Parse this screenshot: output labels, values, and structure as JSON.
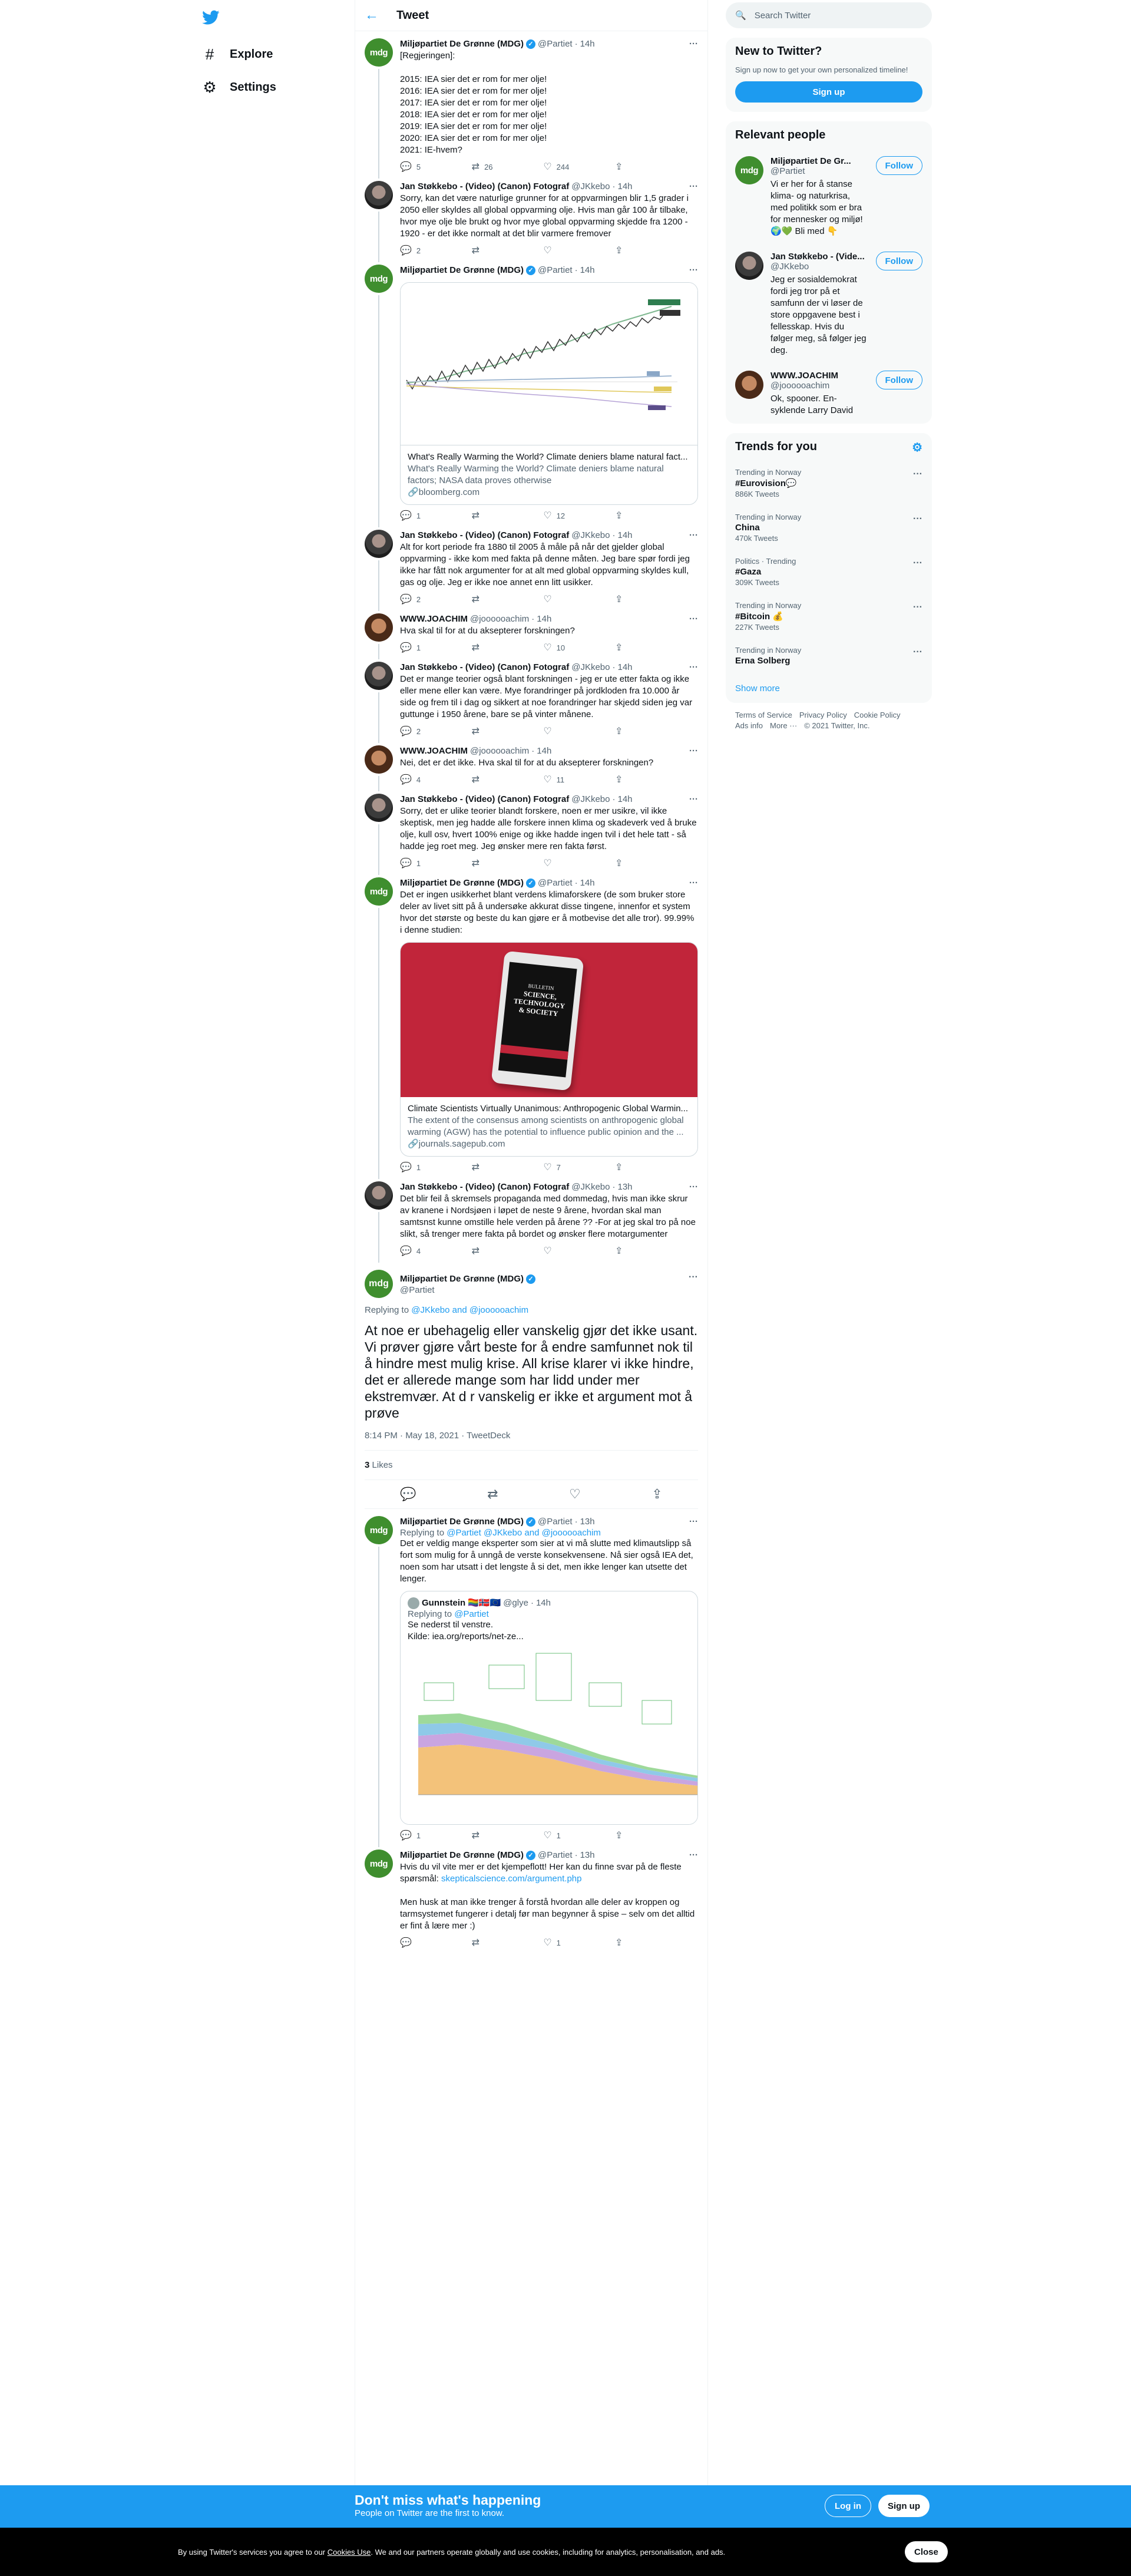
{
  "nav": {
    "items": [
      {
        "icon": "#",
        "label": "Explore"
      },
      {
        "icon": "⚙",
        "label": "Settings"
      }
    ]
  },
  "header": {
    "title": "Tweet"
  },
  "tweets": [
    {
      "name": "Miljøpartiet De Grønne (MDG)",
      "handle": "@Partiet",
      "time": "14h",
      "text": "[Regjeringen]:\n\n2015: IEA sier det er rom for mer olje!\n2016: IEA sier det er rom for mer olje!\n2017: IEA sier det er rom for mer olje!\n2018: IEA sier det er rom for mer olje!\n2019: IEA sier det er rom for mer olje!\n2020: IEA sier det er rom for mer olje!\n2021: IE-hvem?",
      "replies": "5",
      "retweets": "26",
      "likes": "244"
    },
    {
      "name": "Jan Støkkebo - (Video) (Canon) Fotograf",
      "handle": "@JKkebo",
      "time": "14h",
      "text": "Sorry, kan det være naturlige grunner for at oppvarmingen blir 1,5 grader i 2050 eller skyldes all global oppvarming olje. Hvis man går 100 år tilbake, hvor mye olje ble brukt og hvor mye global oppvarming skjedde fra 1200 - 1920 - er det ikke normalt at det blir varmere fremover",
      "replies": "2",
      "retweets": "",
      "likes": ""
    },
    {
      "name": "Miljøpartiet De Grønne (MDG)",
      "handle": "@Partiet",
      "time": "14h",
      "text": "",
      "card": {
        "title": "What's Really Warming the World? Climate deniers blame natural fact...",
        "desc": "What's Really Warming the World? Climate deniers blame natural factors; NASA data proves otherwise",
        "domain": "bloomberg.com"
      },
      "replies": "1",
      "retweets": "",
      "likes": "12"
    },
    {
      "name": "Jan Støkkebo - (Video) (Canon) Fotograf",
      "handle": "@JKkebo",
      "time": "14h",
      "text": "Alt for kort periode fra 1880 til 2005 å måle på når det gjelder global oppvarming - ikke kom med fakta på denne måten. Jeg bare spør fordi jeg ikke har fått nok argumenter for at alt med global oppvarming skyldes kull, gas og olje. Jeg er ikke noe annet enn litt usikker.",
      "replies": "2",
      "retweets": "",
      "likes": ""
    },
    {
      "name": "WWW.JOACHIM",
      "handle": "@joooooachim",
      "time": "14h",
      "text": "Hva skal til for at du aksepterer forskningen?",
      "replies": "1",
      "retweets": "",
      "likes": "10"
    },
    {
      "name": "Jan Støkkebo - (Video) (Canon) Fotograf",
      "handle": "@JKkebo",
      "time": "14h",
      "text": "Det er mange teorier også blant forskningen - jeg er ute etter fakta og ikke eller mene eller kan være. Mye forandringer på jordkloden fra 10.000 år side og frem til i dag og sikkert at noe forandringer har skjedd siden jeg var guttunge i 1950 årene, bare se på vinter månene.",
      "replies": "2",
      "retweets": "",
      "likes": ""
    },
    {
      "name": "WWW.JOACHIM",
      "handle": "@joooooachim",
      "time": "14h",
      "text": "Nei, det er det ikke. Hva skal til for at du aksepterer forskningen?",
      "replies": "4",
      "retweets": "",
      "likes": "11"
    },
    {
      "name": "Jan Støkkebo - (Video) (Canon) Fotograf",
      "handle": "@JKkebo",
      "time": "14h",
      "text": "Sorry, det er ulike teorier blandt forskere, noen er mer usikre, vil ikke skeptisk, men jeg hadde alle forskere innen klima og skadeverk ved å bruke olje, kull osv, hvert 100% enige og ikke hadde ingen tvil i det hele tatt - så hadde jeg roet meg. Jeg ønsker mere ren fakta først.",
      "replies": "1",
      "retweets": "",
      "likes": ""
    },
    {
      "name": "Miljøpartiet De Grønne (MDG)",
      "handle": "@Partiet",
      "time": "14h",
      "text": "Det er ingen usikkerhet blant verdens klimaforskere (de som bruker store deler av livet sitt på å undersøke akkurat disse tingene, innenfor et system hvor det største og beste du kan gjøre er å motbevise det alle tror). 99.99% i denne studien:",
      "card": {
        "title": "Climate Scientists Virtually Unanimous: Anthropogenic Global Warmin...",
        "desc": "The extent of the consensus among scientists on anthropogenic global warming (AGW) has the potential to influence public opinion and the ...",
        "domain": "journals.sagepub.com",
        "book": [
          "BULLETIN",
          "SCIENCE,",
          "TECHNOLOGY",
          "& SOCIETY"
        ]
      },
      "replies": "1",
      "retweets": "",
      "likes": "7"
    },
    {
      "name": "Jan Støkkebo - (Video) (Canon) Fotograf",
      "handle": "@JKkebo",
      "time": "13h",
      "text": "Det blir feil å skremsels propaganda med dommedag, hvis man ikke skrur av kranene i Nordsjøen i løpet de neste 9 årene, hvordan skal man samtsnst kunne omstille hele verden på årene ?? -For at jeg skal tro på noe slikt, så trenger mere fakta på bordet og ønsker flere motargumenter",
      "replies": "4",
      "retweets": "",
      "likes": ""
    }
  ],
  "focus": {
    "name": "Miljøpartiet De Grønne (MDG)",
    "handle": "@Partiet",
    "replying_prefix": "Replying to",
    "replying_to": "@JKkebo and @joooooachim",
    "text": "At noe er ubehagelig eller vanskelig gjør det ikke usant. Vi prøver gjøre vårt beste for å endre samfunnet nok til å hindre mest mulig krise. All krise klarer vi ikke hindre, det er allerede mange som har lidd under mer ekstremvær. At d r vanskelig er ikke et argument mot å prøve",
    "timestamp": "8:14 PM · May 18, 2021 · TweetDeck",
    "likes_count": "3",
    "likes_label": "Likes"
  },
  "replies": [
    {
      "name": "Miljøpartiet De Grønne (MDG)",
      "handle": "@Partiet",
      "time": "13h",
      "replying_prefix": "Replying to",
      "replying_to": "@Partiet @JKkebo and @joooooachim",
      "text": "Det er veldig mange eksperter som sier at vi må slutte med klimautslipp så fort som mulig for å unngå de verste konsekvensene. Nå sier også IEA det, noen som har utsatt i det lengste å si det, men ikke lenger kan utsette det lenger.",
      "quote": {
        "name": "Gunnstein",
        "handle": "@glye",
        "time": "14h",
        "replying_prefix": "Replying to",
        "replying_to": "@Partiet",
        "text": "Se nederst til venstre.\nKilde: iea.org/reports/net-ze..."
      },
      "replies": "1",
      "retweets": "",
      "likes": "1"
    },
    {
      "name": "Miljøpartiet De Grønne (MDG)",
      "handle": "@Partiet",
      "time": "13h",
      "text": "Hvis du vil vite mer er det kjempeflott! Her kan du finne svar på de fleste spørsmål: ",
      "link": "skepticalscience.com/argument.php",
      "text2": "Men husk at man ikke trenger å forstå hvordan alle deler av kroppen og tarmsystemet fungerer i detalj før man begynner å spise – selv om det alltid er fint å lære mer :)",
      "replies": "",
      "retweets": "",
      "likes": "1"
    }
  ],
  "right": {
    "search_placeholder": "Search Twitter",
    "new_title": "New to Twitter?",
    "new_sub": "Sign up now to get your own personalized timeline!",
    "signup": "Sign up",
    "relevant_title": "Relevant people",
    "people": [
      {
        "name": "Miljøpartiet De Gr...",
        "handle": "@Partiet",
        "bio": "Vi er her for å stanse klima- og naturkrisa, med politikk som er bra for mennesker og miljø! 🌍💚 Bli med 👇",
        "follow": "Follow"
      },
      {
        "name": "Jan Støkkebo - (Vide...",
        "handle": "@JKkebo",
        "bio": "Jeg er sosialdemokrat fordi jeg tror på et samfunn der vi løser de store oppgavene best i fellesskap. Hvis du følger meg, så følger jeg deg.",
        "follow": "Follow"
      },
      {
        "name": "WWW.JOACHIM",
        "handle": "@joooooachim",
        "bio": "Ok, spooner. En-syklende Larry David",
        "follow": "Follow"
      }
    ],
    "trends_title": "Trends for you",
    "trends": [
      {
        "cat": "Trending in Norway",
        "name": "#Eurovision💬",
        "count": "886K Tweets"
      },
      {
        "cat": "Trending in Norway",
        "name": "China",
        "count": "470k Tweets"
      },
      {
        "cat": "Politics · Trending",
        "name": "#Gaza",
        "count": "309K Tweets"
      },
      {
        "cat": "Trending in Norway",
        "name": "#Bitcoin 💰",
        "count": "227K Tweets"
      },
      {
        "cat": "Trending in Norway",
        "name": "Erna Solberg",
        "count": ""
      }
    ],
    "show_more": "Show more",
    "footer": [
      "Terms of Service",
      "Privacy Policy",
      "Cookie Policy",
      "Ads info",
      "More ···",
      "© 2021 Twitter, Inc."
    ]
  },
  "bottom": {
    "title": "Don't miss what's happening",
    "sub": "People on Twitter are the first to know.",
    "login": "Log in",
    "signup": "Sign up"
  },
  "cookie": {
    "text_pre": "By using Twitter's services you agree to our",
    "link": "Cookies Use",
    "text_post": ". We and our partners operate globally and use cookies, including for analytics, personalisation, and ads.",
    "close": "Close"
  }
}
